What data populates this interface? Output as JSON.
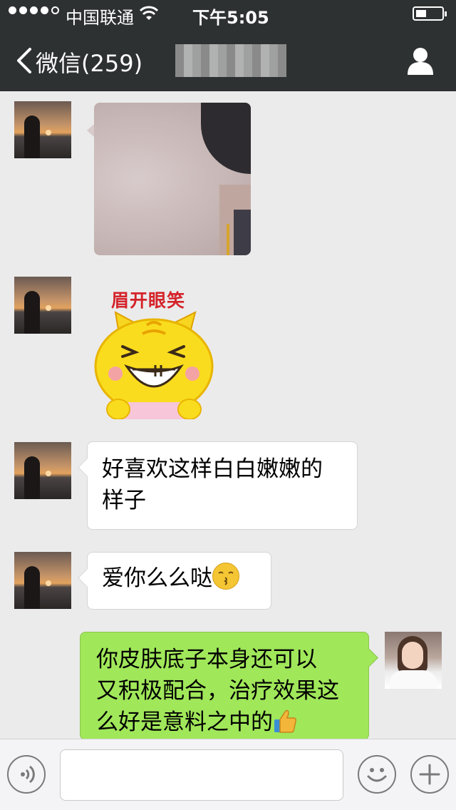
{
  "status_bar": {
    "carrier": "中国联通",
    "time": "下午5:05",
    "signal_bars": 4,
    "battery_level": 0.35
  },
  "nav": {
    "back_label": "微信(259)",
    "chat_title": ""
  },
  "messages": [
    {
      "type": "image",
      "sender": "contact",
      "description_icon": "photo"
    },
    {
      "type": "sticker",
      "sender": "contact",
      "caption": "眉开眼笑"
    },
    {
      "type": "text",
      "sender": "contact",
      "lines": [
        "好喜欢这样白白嫩嫩的",
        "样子"
      ]
    },
    {
      "type": "text",
      "sender": "contact",
      "text": "爱你么么哒"
    },
    {
      "type": "text",
      "sender": "me",
      "lines": [
        "你皮肤底子本身还可以",
        "又积极配合，治疗效果这",
        "么好是意料之中的"
      ]
    }
  ],
  "input_bar": {
    "placeholder": ""
  },
  "colors": {
    "nav_bg": "#2e3132",
    "chat_bg": "#ebebeb",
    "my_bubble": "#a0e75a",
    "their_bubble": "#ffffff"
  }
}
